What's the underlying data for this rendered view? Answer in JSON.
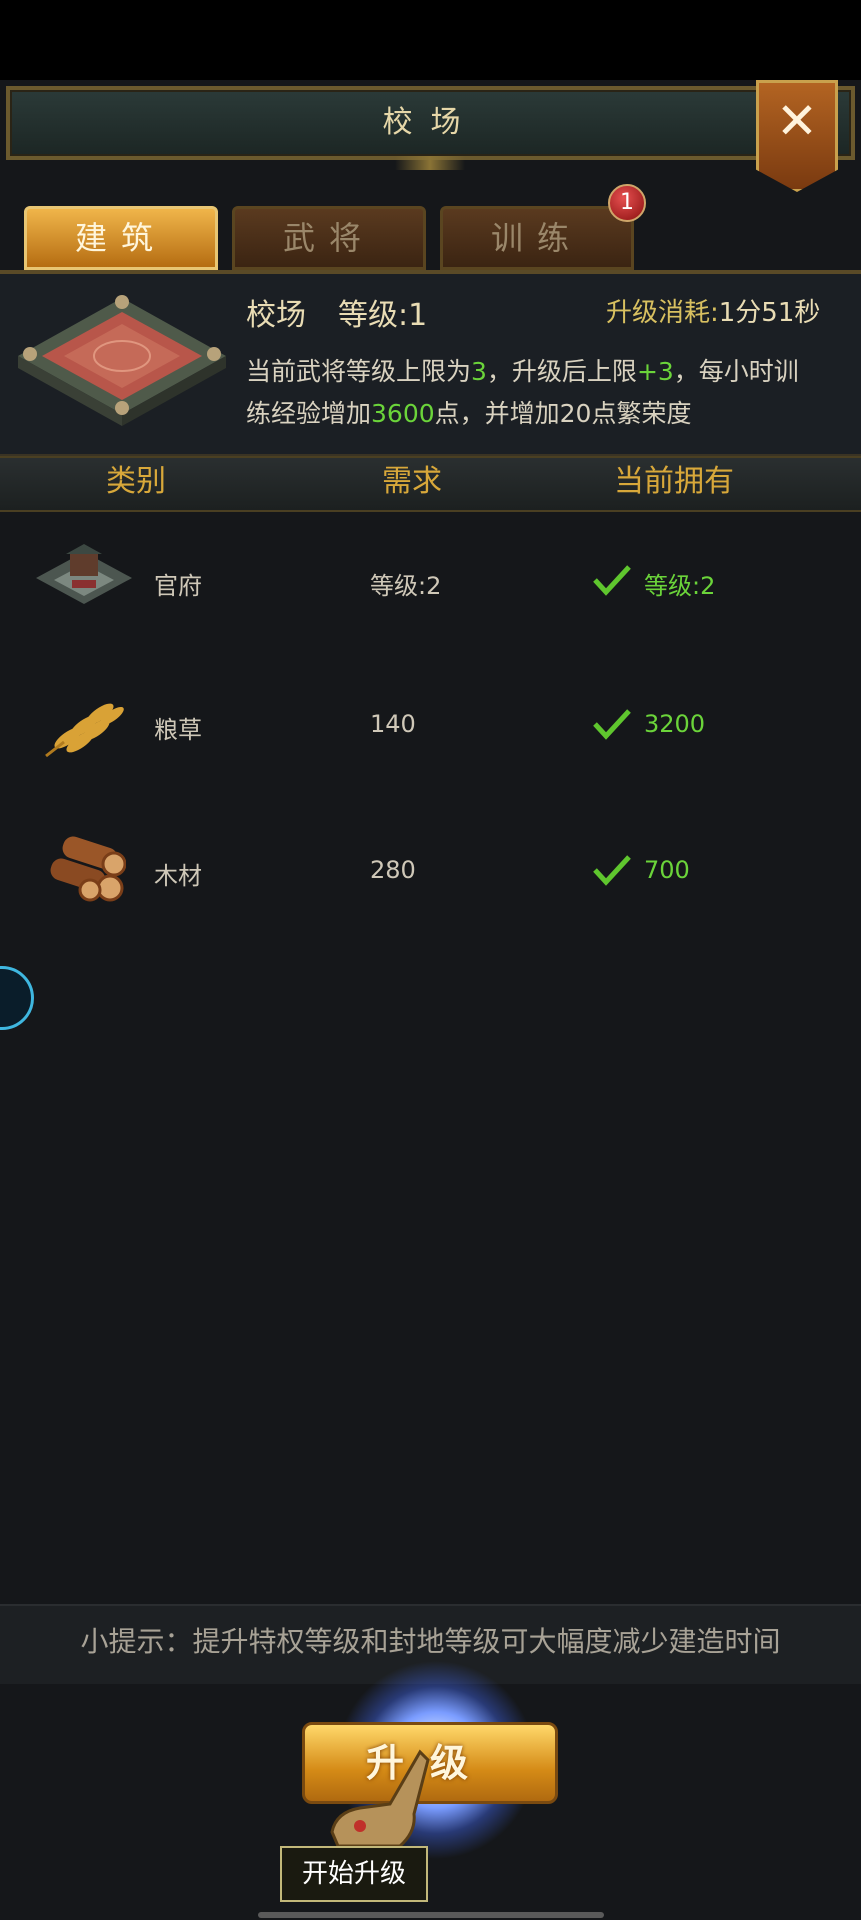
{
  "window": {
    "title": "校场",
    "close_label": "✕"
  },
  "tabs": [
    {
      "label": "建筑",
      "active": true
    },
    {
      "label": "武将",
      "active": false
    },
    {
      "label": "训练",
      "active": false,
      "badge": "1"
    }
  ],
  "info": {
    "building_name": "校场",
    "level_label": "等级:1",
    "cost_label": "升级消耗:",
    "cost_value": "1分51秒",
    "desc_line1_a": "当前武将等级上限为",
    "desc_line1_b": "3",
    "desc_line1_c": "，升级后上限",
    "desc_line1_d": "+3",
    "desc_line1_e": "，每小时训",
    "desc_line2_a": "练经验增加",
    "desc_line2_b": "3600",
    "desc_line2_c": "点，并增加20点繁荣度"
  },
  "table": {
    "headers": [
      "类别",
      "需求",
      "当前拥有"
    ],
    "rows": [
      {
        "name": "官府",
        "icon": "government-building-icon",
        "requirement": "等级:2",
        "owned": "等级:2"
      },
      {
        "name": "粮草",
        "icon": "wheat-icon",
        "requirement": "140",
        "owned": "3200"
      },
      {
        "name": "木材",
        "icon": "wood-logs-icon",
        "requirement": "280",
        "owned": "700"
      }
    ]
  },
  "hint": "小提示：提升特权等级和封地等级可大幅度减少建造时间",
  "upgrade_button": "升级",
  "tooltip": "开始升级",
  "colors": {
    "accent_gold": "#d8a83a",
    "ok_green": "#6bd43a"
  }
}
